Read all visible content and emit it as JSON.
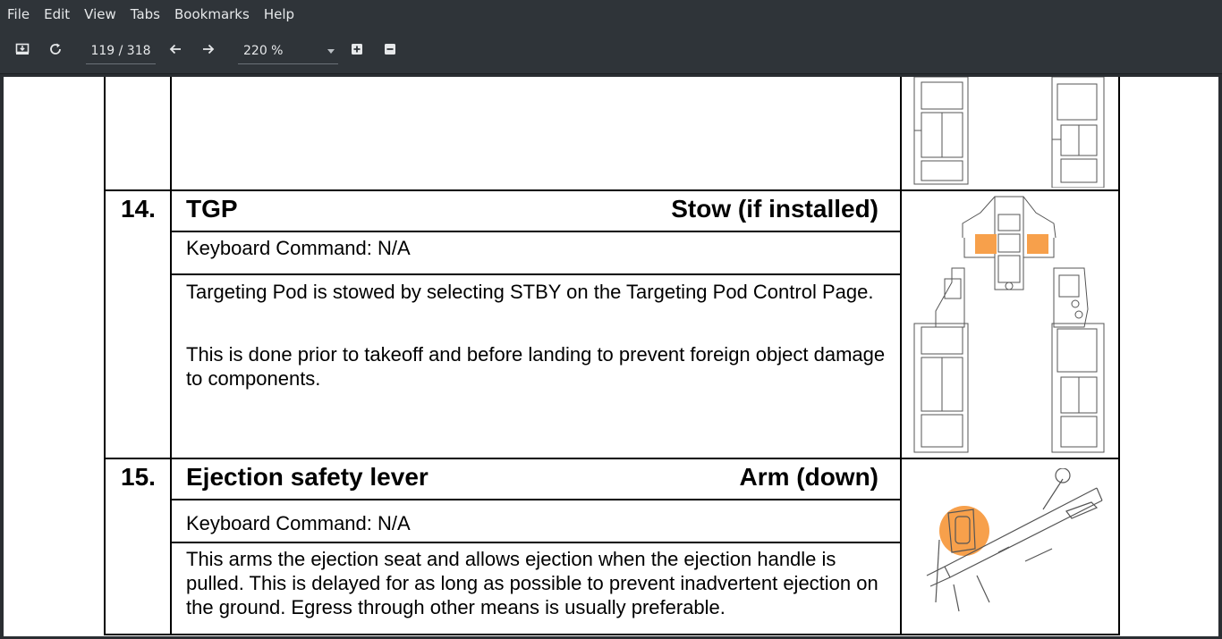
{
  "menu": {
    "items": [
      "File",
      "Edit",
      "View",
      "Tabs",
      "Bookmarks",
      "Help"
    ]
  },
  "toolbar": {
    "page_indicator": "119 / 318",
    "zoom_value": "220 %",
    "icons": [
      "sidebar-toggle-icon",
      "reload-icon",
      "arrow-left-icon",
      "arrow-right-icon",
      "zoom-in-icon",
      "zoom-out-icon"
    ]
  },
  "document": {
    "rows": [
      {
        "number": "14.",
        "title": "TGP",
        "action": "Stow (if installed)",
        "keyboard": "Keyboard Command: N/A",
        "paragraphs": [
          "Targeting Pod is stowed by selecting STBY on the Targeting Pod Control Page.",
          "This is done prior to takeoff and before landing to prevent foreign object damage to components."
        ]
      },
      {
        "number": "15.",
        "title": "Ejection safety lever",
        "action": "Arm (down)",
        "keyboard": "Keyboard Command: N/A",
        "paragraphs": [
          "This arms the ejection seat and allows ejection when the ejection handle is pulled. This is delayed for as long as possible to prevent inadvertent ejection on the ground. Egress through other means is usually preferable."
        ]
      }
    ]
  },
  "colors": {
    "chrome_bg": "#2f3439",
    "chrome_text": "#e6e8ea",
    "highlight": "#f7a04b",
    "page_bg": "#ffffff"
  }
}
